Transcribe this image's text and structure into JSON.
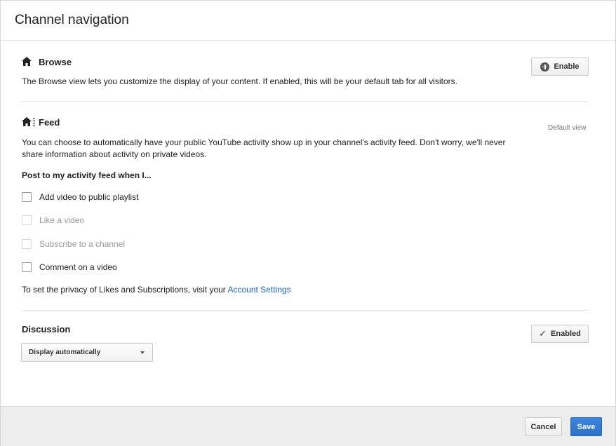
{
  "header": {
    "title": "Channel navigation"
  },
  "browse": {
    "title": "Browse",
    "description": "The Browse view lets you customize the display of your content. If enabled, this will be your default tab for all visitors.",
    "enable_label": "Enable"
  },
  "feed": {
    "title": "Feed",
    "default_view_label": "Default view",
    "description_line1": "You can choose to automatically have your public YouTube activity show up in your channel's activity feed. Don't worry, we'll never",
    "description_line2": "share information about activity on private videos.",
    "post_heading": "Post to my activity feed when I...",
    "options": [
      {
        "label": "Add video to public playlist",
        "checked": false,
        "disabled": false
      },
      {
        "label": "Like a video",
        "checked": false,
        "disabled": true
      },
      {
        "label": "Subscribe to a channel",
        "checked": false,
        "disabled": true
      },
      {
        "label": "Comment on a video",
        "checked": false,
        "disabled": false
      }
    ],
    "privacy_text": "To set the privacy of Likes and Subscriptions, visit your ",
    "privacy_link": "Account Settings"
  },
  "discussion": {
    "title": "Discussion",
    "enabled_label": "Enabled",
    "select_value": "Display automatically"
  },
  "footer": {
    "cancel_label": "Cancel",
    "save_label": "Save"
  },
  "colors": {
    "link": "#1f63c6",
    "primary_button": "#2e72c7"
  },
  "icons": [
    "home-icon",
    "plus-circle-icon",
    "home-feed-icon",
    "check-icon",
    "chevron-down-icon"
  ]
}
